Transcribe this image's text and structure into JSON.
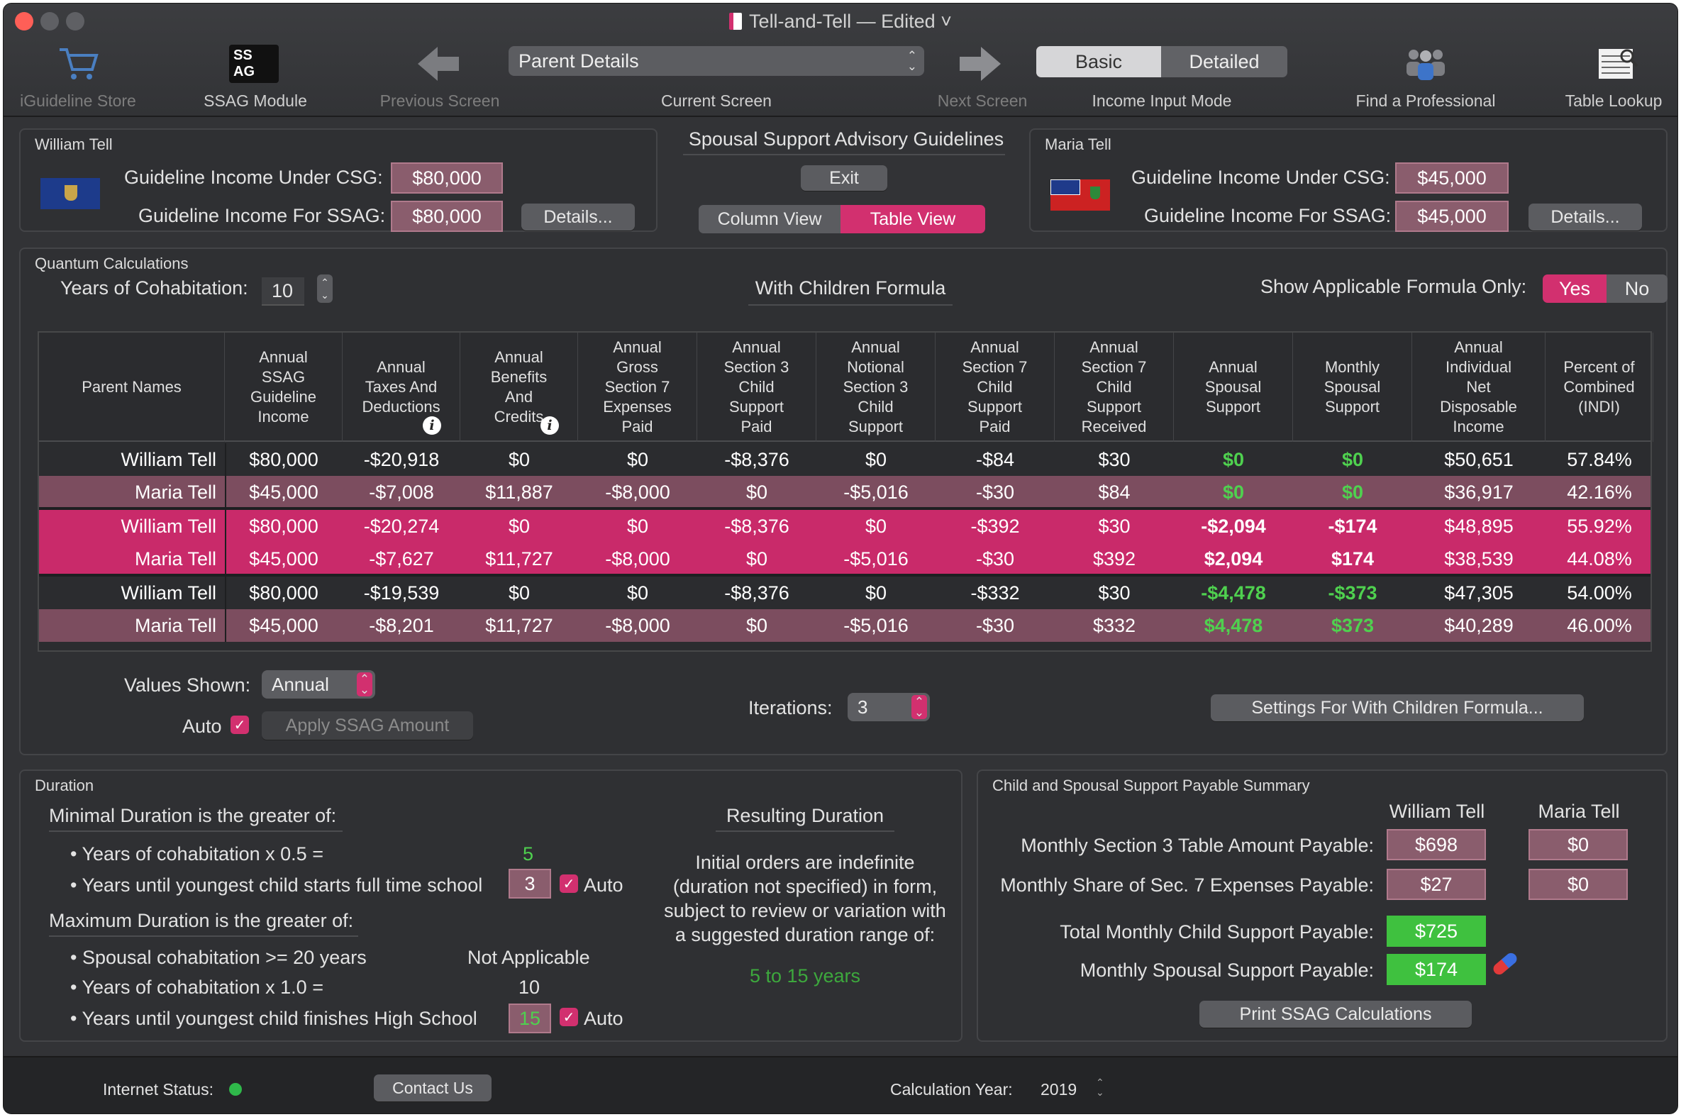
{
  "window": {
    "title": "Tell-and-Tell — Edited ˅"
  },
  "toolbar": {
    "store": "iGuideline Store",
    "ssag_module": "SSAG Module",
    "ssag_icon_text": "SS AG",
    "previous": "Previous Screen",
    "current_screen_value": "Parent Details",
    "current_screen": "Current Screen",
    "next": "Next Screen",
    "mode_basic": "Basic",
    "mode_detailed": "Detailed",
    "mode_label": "Income Input Mode",
    "find_professional": "Find a Professional",
    "table_lookup": "Table Lookup"
  },
  "parent1": {
    "name": "William Tell",
    "csg_label": "Guideline Income Under CSG:",
    "csg_value": "$80,000",
    "ssag_label": "Guideline Income For SSAG:",
    "ssag_value": "$80,000",
    "details": "Details..."
  },
  "parent2": {
    "name": "Maria Tell",
    "csg_label": "Guideline Income Under CSG:",
    "csg_value": "$45,000",
    "ssag_label": "Guideline Income For SSAG:",
    "ssag_value": "$45,000",
    "details": "Details..."
  },
  "center": {
    "title": "Spousal Support Advisory Guidelines",
    "exit": "Exit",
    "column_view": "Column View",
    "table_view": "Table View"
  },
  "quantum": {
    "title": "Quantum Calculations",
    "years_label": "Years of Cohabitation:",
    "years_value": "10",
    "formula": "With Children Formula",
    "show_only_label": "Show Applicable Formula Only:",
    "yes": "Yes",
    "no": "No",
    "headers": [
      "Parent Names",
      "Annual SSAG Guideline Income",
      "Annual Taxes And Deductions",
      "Annual Benefits And Credits",
      "Annual Gross Section 7 Expenses Paid",
      "Annual Section 3 Child Support Paid",
      "Annual Notional Section 3 Child Support",
      "Annual Section 7 Child Support Paid",
      "Annual Section 7 Child Support Received",
      "Annual Spousal Support",
      "Monthly Spousal Support",
      "Annual Individual Net Disposable Income",
      "Percent of Combined (INDI)"
    ],
    "rows": [
      [
        "William Tell",
        "$80,000",
        "-$20,918",
        "$0",
        "$0",
        "-$8,376",
        "$0",
        "-$84",
        "$30",
        "$0",
        "$0",
        "$50,651",
        "57.84%"
      ],
      [
        "Maria Tell",
        "$45,000",
        "-$7,008",
        "$11,887",
        "-$8,000",
        "$0",
        "-$5,016",
        "-$30",
        "$84",
        "$0",
        "$0",
        "$36,917",
        "42.16%"
      ],
      [
        "William Tell",
        "$80,000",
        "-$20,274",
        "$0",
        "$0",
        "-$8,376",
        "$0",
        "-$392",
        "$30",
        "-$2,094",
        "-$174",
        "$48,895",
        "55.92%"
      ],
      [
        "Maria Tell",
        "$45,000",
        "-$7,627",
        "$11,727",
        "-$8,000",
        "$0",
        "-$5,016",
        "-$30",
        "$392",
        "$2,094",
        "$174",
        "$38,539",
        "44.08%"
      ],
      [
        "William Tell",
        "$80,000",
        "-$19,539",
        "$0",
        "$0",
        "-$8,376",
        "$0",
        "-$332",
        "$30",
        "-$4,478",
        "-$373",
        "$47,305",
        "54.00%"
      ],
      [
        "Maria Tell",
        "$45,000",
        "-$8,201",
        "$11,727",
        "-$8,000",
        "$0",
        "-$5,016",
        "-$30",
        "$332",
        "$4,478",
        "$373",
        "$40,289",
        "46.00%"
      ]
    ],
    "values_shown_label": "Values Shown:",
    "values_shown": "Annual",
    "auto_label": "Auto",
    "apply_ssag": "Apply SSAG Amount",
    "iterations_label": "Iterations:",
    "iterations": "3",
    "settings_button": "Settings For With Children Formula..."
  },
  "duration": {
    "title": "Duration",
    "min_heading": "Minimal Duration is the greater of:",
    "min_item1": "• Years of cohabitation x 0.5 =",
    "min_item1_value": "5",
    "min_item2": "• Years until youngest child starts full time school",
    "min_item2_value": "3",
    "auto": "Auto",
    "max_heading": "Maximum Duration is the greater of:",
    "max_item1": "• Spousal cohabitation >= 20 years",
    "max_item1_value": "Not Applicable",
    "max_item2": "• Years of cohabitation x 1.0 =",
    "max_item2_value": "10",
    "max_item3": "• Years until youngest child finishes High School",
    "max_item3_value": "15",
    "resulting_title": "Resulting Duration",
    "resulting_line1": "Initial orders are indefinite",
    "resulting_line2": "(duration not specified) in form,",
    "resulting_line3": "subject to review or variation with",
    "resulting_line4": "a suggested duration range of:",
    "resulting_range": "5 to 15 years"
  },
  "summary": {
    "title": "Child and Spousal Support Payable Summary",
    "col1": "William Tell",
    "col2": "Maria Tell",
    "s3_label": "Monthly Section 3 Table Amount Payable:",
    "s3_p1": "$698",
    "s3_p2": "$0",
    "s7_label": "Monthly Share of Sec. 7 Expenses Payable:",
    "s7_p1": "$27",
    "s7_p2": "$0",
    "total_label": "Total Monthly Child Support Payable:",
    "total_p1": "$725",
    "spousal_label": "Monthly Spousal Support Payable:",
    "spousal_p1": "$174",
    "print": "Print SSAG Calculations"
  },
  "footer": {
    "internet_label": "Internet Status:",
    "contact": "Contact Us",
    "calc_year_label": "Calculation Year:",
    "calc_year": "2019"
  },
  "colors": {
    "accent": "#d2306f",
    "green": "#4fd14f",
    "field": "#8a5d6d"
  }
}
